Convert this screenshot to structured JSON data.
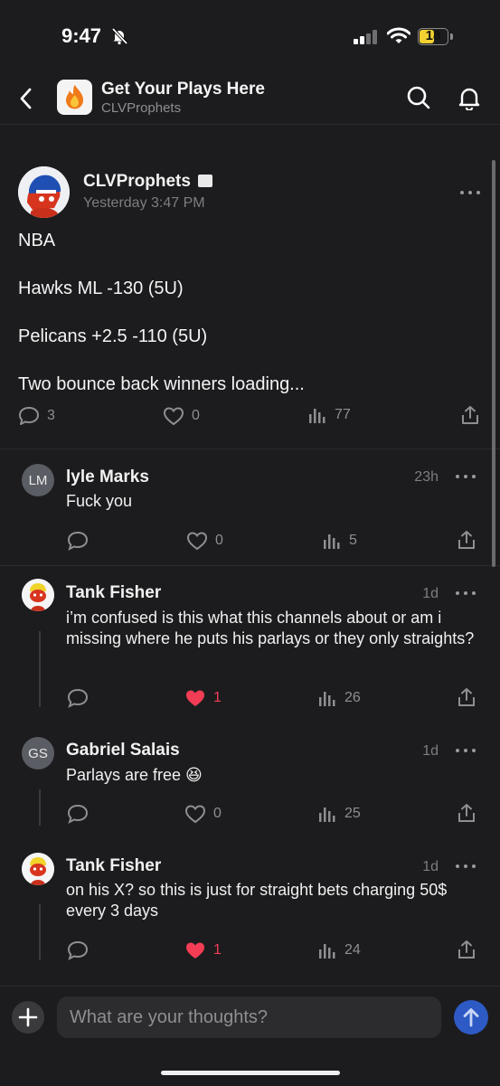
{
  "status_bar": {
    "time": "9:47",
    "battery": "18"
  },
  "header": {
    "title": "Get Your Plays Here",
    "subtitle": "CLVProphets"
  },
  "post": {
    "author": "CLVProphets",
    "timestamp": "Yesterday 3:47 PM",
    "lines": [
      "NBA",
      "Hawks ML -130 (5U)",
      "Pelicans +2.5 -110 (5U)",
      "Two bounce back winners loading..."
    ],
    "comments_count": "3",
    "likes": "0",
    "views": "77"
  },
  "comments": [
    {
      "initials": "LM",
      "name": "lyle Marks",
      "time": "23h",
      "text": "Fuck you",
      "likes": "0",
      "views": "5",
      "liked": false
    },
    {
      "name": "Tank Fisher",
      "time": "1d",
      "text": "i’m confused is this what this channels about or am i missing where he puts his parlays or they only straights?",
      "likes": "1",
      "views": "26",
      "liked": true
    },
    {
      "initials": "GS",
      "name": "Gabriel Salais",
      "time": "1d",
      "text": "Parlays are free 😆",
      "likes": "0",
      "views": "25",
      "liked": false
    },
    {
      "name": "Tank Fisher",
      "time": "1d",
      "text": "on his X? so this is just for straight bets charging 50$ every 3 days",
      "likes": "1",
      "views": "24",
      "liked": true
    }
  ],
  "composer": {
    "placeholder": "What are your thoughts?"
  },
  "colors": {
    "background": "#1c1c1e",
    "like_active": "#f23d55",
    "send": "#2d5ac4",
    "battery": "#f2d230"
  }
}
